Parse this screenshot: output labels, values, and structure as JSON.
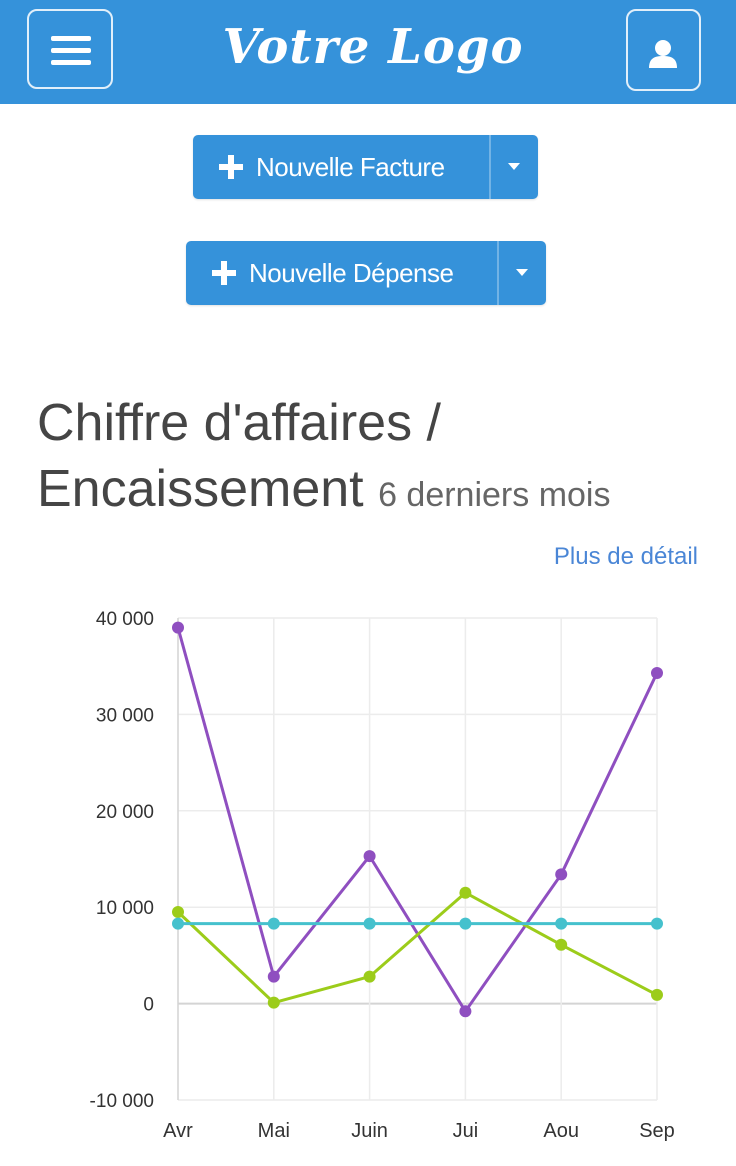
{
  "header": {
    "logo_text": "Votre Logo",
    "menu_icon": "hamburger-menu-icon",
    "user_icon": "user-icon",
    "background": "#3592da"
  },
  "actions": [
    {
      "label": "Nouvelle Facture",
      "icon": "plus-icon",
      "dropdown_icon": "caret-down-icon"
    },
    {
      "label": "Nouvelle Dépense",
      "icon": "plus-icon",
      "dropdown_icon": "caret-down-icon"
    }
  ],
  "section": {
    "title_line1": "Chiffre d'affaires /",
    "title_line2": "Encaissement",
    "subtitle": "6 derniers mois",
    "detail_link": "Plus de détail"
  },
  "chart_data": {
    "type": "line",
    "title": "",
    "xlabel": "",
    "ylabel": "",
    "categories": [
      "Avr",
      "Mai",
      "Juin",
      "Jui",
      "Aou",
      "Sep"
    ],
    "y_ticks": [
      "40 000",
      "30 000",
      "20 000",
      "10 000",
      "0",
      "-10 000"
    ],
    "ylim": [
      -10000,
      40000
    ],
    "grid": true,
    "legend": "none",
    "series": [
      {
        "color": "#8f4fc0",
        "values": [
          39000,
          2800,
          15300,
          -800,
          13400,
          34300
        ]
      },
      {
        "color": "#9ccc1a",
        "values": [
          9500,
          100,
          2800,
          11500,
          6100,
          900
        ]
      },
      {
        "color": "#45c1cd",
        "values": [
          8300,
          8300,
          8300,
          8300,
          8300,
          8300
        ]
      }
    ]
  }
}
